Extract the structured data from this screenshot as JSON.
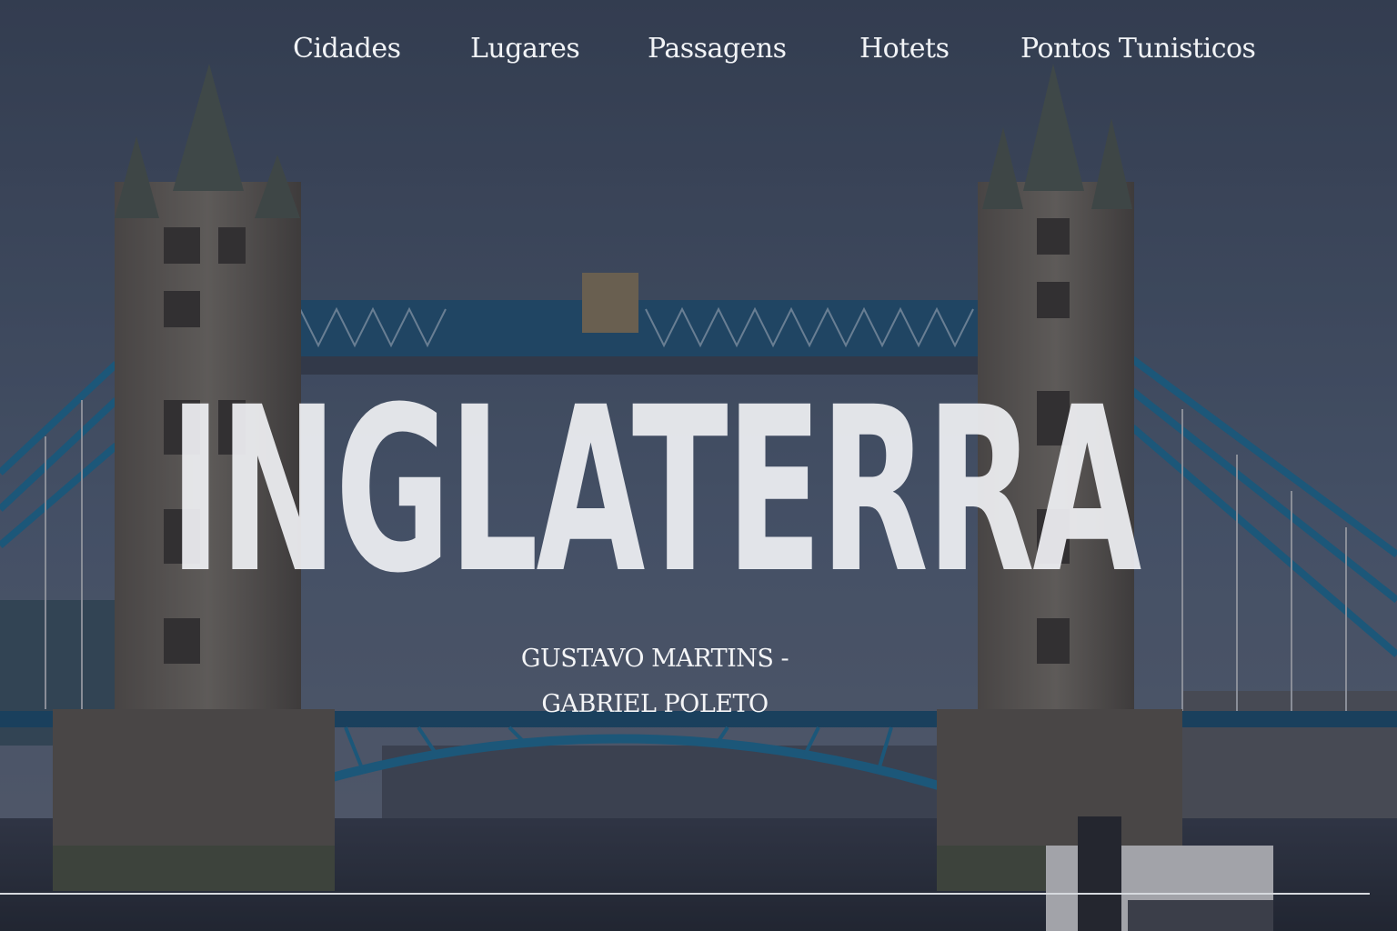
{
  "nav": {
    "items": [
      {
        "label": "Cidades"
      },
      {
        "label": "Lugares"
      },
      {
        "label": "Passagens"
      },
      {
        "label": "Hotets"
      },
      {
        "label": "Pontos Tunisticos"
      }
    ]
  },
  "hero": {
    "title": "INGLATERRA",
    "authors_line1": "GUSTAVO MARTINS -",
    "authors_line2": "GABRIEL POLETO",
    "background_image": "tower-bridge-photo"
  },
  "colors": {
    "sky": "#4a5a72",
    "stone": "#6b655e",
    "bridge_blue": "#1f6f99",
    "water": "#2f3644",
    "text": "#f1f3f6"
  }
}
